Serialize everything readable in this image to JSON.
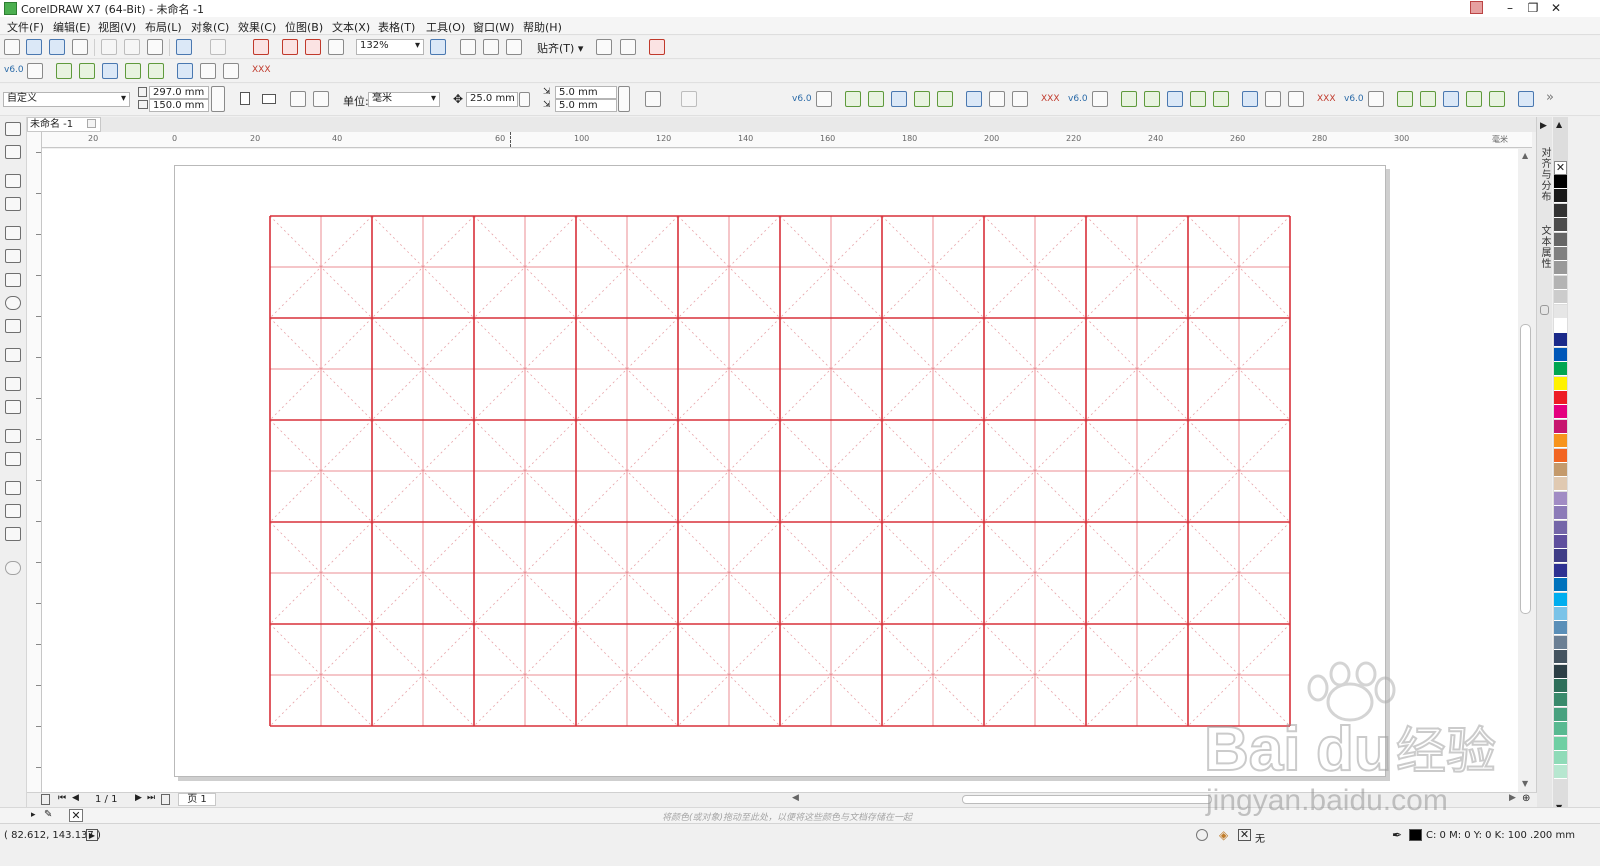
{
  "app": {
    "title": "CorelDRAW X7 (64-Bit) - 未命名 -1",
    "window_controls": {
      "minimize": "minimize-icon",
      "restore": "restore-icon",
      "close": "close-icon"
    }
  },
  "menu": [
    "文件(F)",
    "编辑(E)",
    "视图(V)",
    "布局(L)",
    "对象(C)",
    "效果(C)",
    "位图(B)",
    "文本(X)",
    "表格(T)",
    "工具(O)",
    "窗口(W)",
    "帮助(H)"
  ],
  "standard_toolbar": {
    "zoom_value": "132%",
    "snap_label": "贴齐(T)"
  },
  "property_bar": {
    "page_preset": "自定义",
    "page_width": "297.0 mm",
    "page_height": "150.0 mm",
    "units_label": "单位:",
    "units_value": "毫米",
    "nudge_distance": "25.0 mm",
    "duplicate_x": "5.0 mm",
    "duplicate_y": "5.0 mm"
  },
  "document": {
    "tab_name": "未命名 -1"
  },
  "ruler": {
    "h_labels": [
      "20",
      "0",
      "20",
      "40",
      "60",
      "80",
      "100",
      "120",
      "140",
      "160",
      "180",
      "200",
      "220",
      "240",
      "260",
      "280",
      "300"
    ],
    "unit_label": "毫米"
  },
  "grid": {
    "cols": 10,
    "rows": 5,
    "line_color": "#d9303a",
    "sub_color": "#eb8d93",
    "diag_color": "#e7a3a8"
  },
  "dockers": [
    "对齐与分布",
    "文本属性"
  ],
  "palette_colors": [
    "#ffffff",
    "#000000",
    "#1a1a1a",
    "#333333",
    "#4d4d4d",
    "#666666",
    "#808080",
    "#999999",
    "#b3b3b3",
    "#cccccc",
    "#e6e6e6",
    "#ffffff",
    "#1b2a8a",
    "#0057b8",
    "#00a651",
    "#fff200",
    "#ed1c24",
    "#e4007f",
    "#c7166f",
    "#f7941d",
    "#f26522",
    "#c49a6c",
    "#e0c9b1",
    "#a18cc4",
    "#8c7bb8",
    "#7466a8",
    "#5f4f9e",
    "#3f3d86",
    "#2e3192",
    "#0072bc",
    "#00aeef",
    "#7ac3e8",
    "#5a8fb8",
    "#6b7f94",
    "#44535f",
    "#2d3f46",
    "#2e6f5a",
    "#3a8a6c",
    "#48a17f",
    "#59b991",
    "#6fcfa3",
    "#8fdbb8",
    "#b7e7d0"
  ],
  "page_nav": {
    "counter": "1 / 1",
    "page_tab": "页 1"
  },
  "color_bar_hint": "将颜色(或对象)拖动至此处，以便将这些颜色与文档存储在一起",
  "status": {
    "coords": "( 82.612, 143.137 )",
    "fill_label": "无",
    "outline_info": "C: 0 M: 0 Y: 0 K: 100  .200 mm"
  },
  "watermark": {
    "brand": "Bai",
    "brand_suffix": "du",
    "cn": "经验",
    "url": "jingyan.baidu.com"
  }
}
